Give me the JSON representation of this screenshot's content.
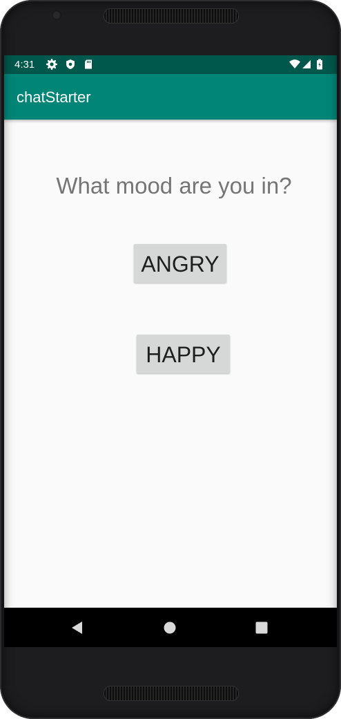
{
  "status_bar": {
    "time": "4:31",
    "icons": [
      "gear-icon",
      "shield-icon",
      "sd-card-icon"
    ],
    "right_icons": [
      "wifi-icon",
      "cell-signal-icon",
      "battery-icon"
    ],
    "color": "#00574b"
  },
  "app_bar": {
    "title": "chatStarter",
    "color": "#008577"
  },
  "main": {
    "question": "What mood are you in?",
    "buttons": [
      {
        "label": "ANGRY"
      },
      {
        "label": "HAPPY"
      }
    ]
  },
  "nav_bar": {
    "buttons": [
      "back-icon",
      "home-icon",
      "recents-icon"
    ]
  }
}
